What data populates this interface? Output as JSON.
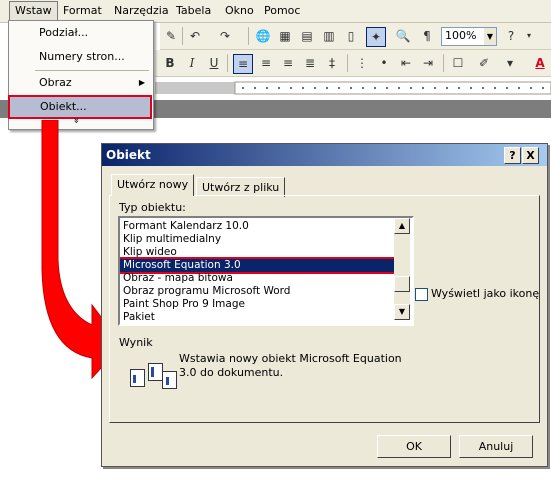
{
  "menubar": {
    "items": [
      "Wstaw",
      "Format",
      "Narzędzia",
      "Tabela",
      "Okno",
      "Pomoc"
    ]
  },
  "toolbar": {
    "zoom": "100%"
  },
  "insert_menu": {
    "items": [
      "Podział...",
      "Numery stron...",
      "Obraz",
      "Obiekt..."
    ],
    "more": "»"
  },
  "dialog": {
    "title": "Obiekt",
    "help_btn": "?",
    "close_btn": "X",
    "tabs": [
      "Utwórz nowy",
      "Utwórz z pliku"
    ],
    "object_type_label": "Typ obiektu:",
    "object_types": [
      "Formant Kalendarz 10.0",
      "Klip multimedialny",
      "Klip wideo",
      "Microsoft Equation 3.0",
      "Obraz - mapa bitowa",
      "Obraz programu Microsoft Word",
      "Paint Shop Pro 9 Image",
      "Pakiet"
    ],
    "selected_type": "Microsoft Equation 3.0",
    "display_as_icon": "Wyświetl jako ikonę",
    "result_label": "Wynik",
    "result_text": "Wstawia nowy obiekt Microsoft Equation 3.0 do dokumentu.",
    "ok": "OK",
    "cancel": "Anuluj"
  },
  "colors": {
    "highlight": "#e0001b",
    "selection": "#0a246a",
    "dialog_bg": "#ece9d8"
  }
}
